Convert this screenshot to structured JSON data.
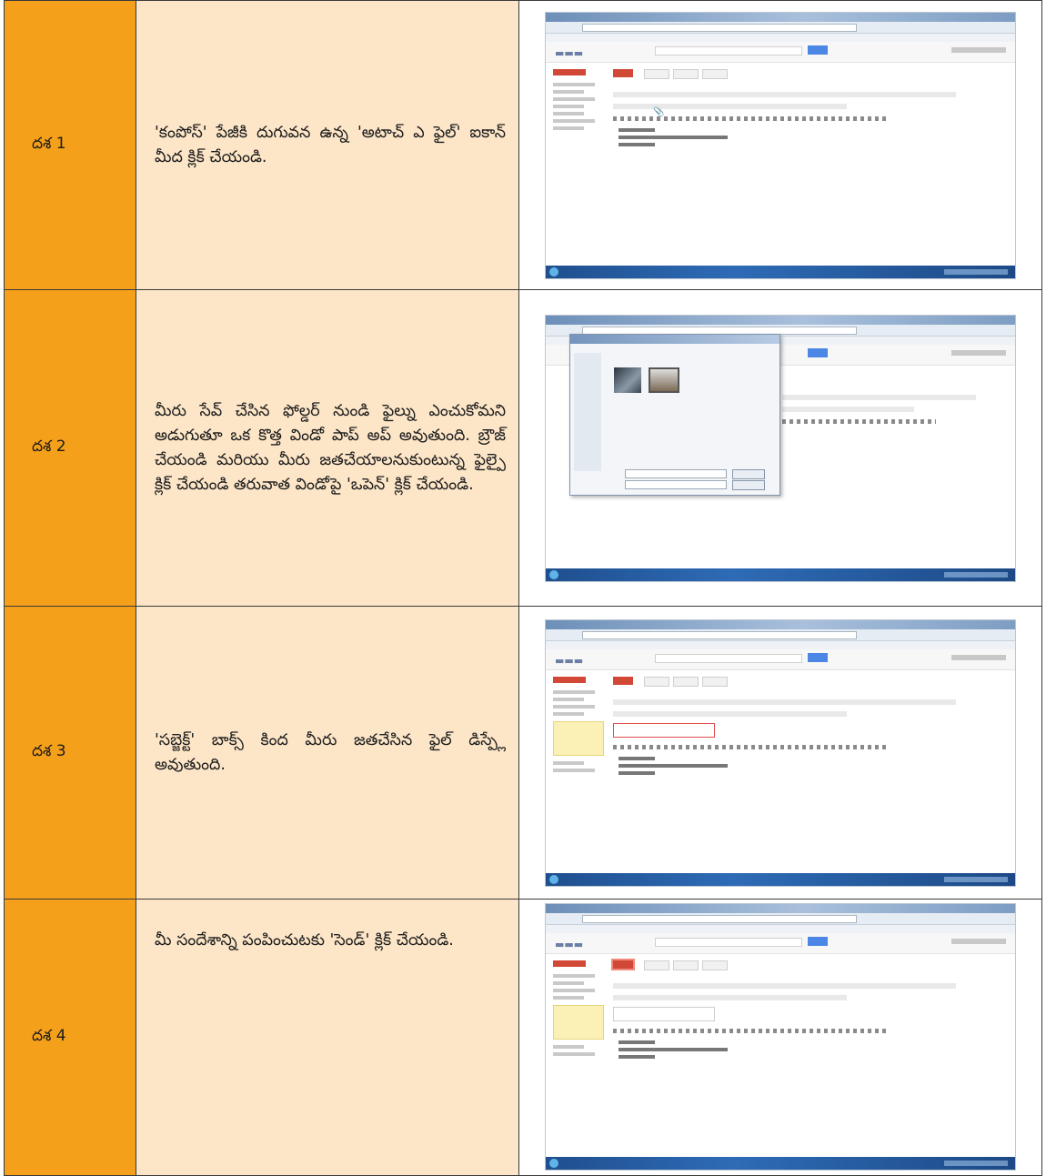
{
  "steps": [
    {
      "label": "దశ 1",
      "text": "'కంపోస్' పేజీకి దుగువన ఉన్న 'అటాచ్ ఎ ఫైల్' ఐకాన్ మీద క్లిక్ చేయండి.",
      "screenshot_variant": "compose-attach-icon"
    },
    {
      "label": "దశ 2",
      "text": "మీరు సేవ్ చేసిన ఫోల్డర్ నుండి ఫైల్ను ఎంచుకోమని అడుగుతూ ఒక కొత్త విండో పాప్ అప్ అవుతుంది. బ్రౌజ్ చేయండి మరియు మీరు జతచేయాలనుకుంటున్న ఫైల్పై క్లిక్ చేయండి తరువాత విండోపై 'ఒపెన్' క్లిక్ చేయండి.",
      "screenshot_variant": "file-open-dialog"
    },
    {
      "label": "దశ 3",
      "text": "'సబ్జెక్ట్' బాక్స్ కింద మీరు జతచేసిన ఫైల్ డిస్ప్లే అవుతుంది.",
      "screenshot_variant": "attachment-shown"
    },
    {
      "label": "దశ 4",
      "text": "మీ సందేశాన్ని పంపించుటకు 'సెండ్' క్లిక్ చేయండి.",
      "screenshot_variant": "send-button"
    }
  ]
}
